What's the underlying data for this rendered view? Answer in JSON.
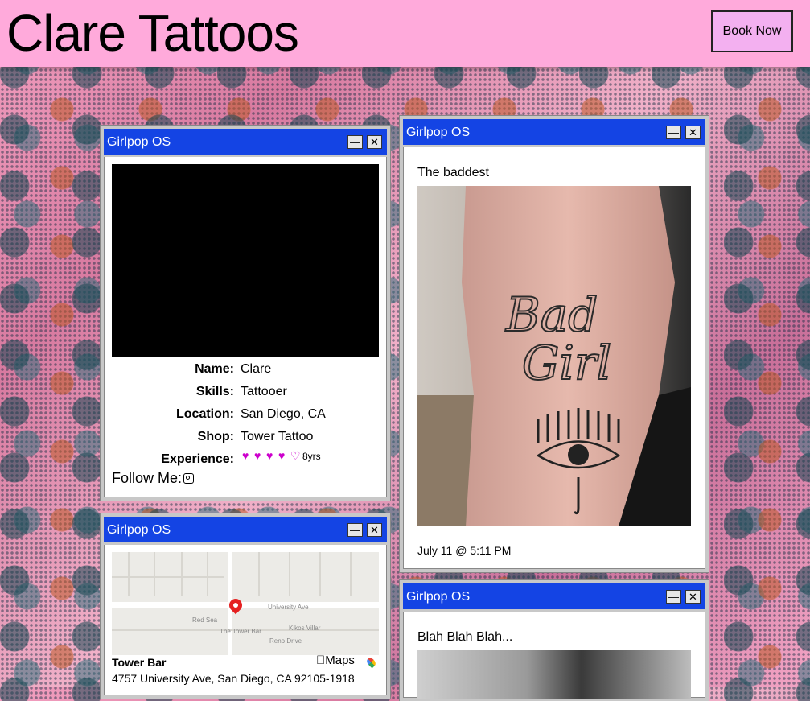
{
  "header": {
    "title": "Clare Tattoos",
    "book_label": "Book Now"
  },
  "profile_window": {
    "title": "Girlpop OS",
    "minimize": "—",
    "close": "✕",
    "fields": {
      "name_key": "Name:",
      "name": "Clare",
      "skills_key": "Skills:",
      "skills": "Tattooer",
      "location_key": "Location:",
      "location": "San Diego, CA",
      "shop_key": "Shop:",
      "shop": "Tower Tattoo",
      "experience_key": "Experience:",
      "experience_text": "8yrs",
      "experience_rating": 4,
      "experience_max": 5
    },
    "follow_label": "Follow Me:",
    "follow_icon": "instagram-icon"
  },
  "map_window": {
    "title": "Girlpop OS",
    "minimize": "—",
    "close": "✕",
    "map_labels": {
      "street": "University Ave",
      "red_sea": "Red Sea",
      "tower_bar": "The Tower Bar",
      "kiko": "Kikos Villar",
      "reno": "Reno Drive"
    },
    "place_name": "Tower Bar",
    "address": "4757 University Ave, San Diego, CA 92105-1918",
    "maps_brand": "Maps"
  },
  "post_window_1": {
    "title": "Girlpop OS",
    "minimize": "—",
    "close": "✕",
    "caption": "The baddest",
    "date": "July 11 @ 5:11 PM"
  },
  "post_window_2": {
    "title": "Girlpop OS",
    "minimize": "—",
    "close": "✕",
    "caption": "Blah Blah Blah..."
  },
  "colors": {
    "header_bg": "#ffaadb",
    "titlebar": "#1444e4",
    "heart": "#cc00cc"
  }
}
